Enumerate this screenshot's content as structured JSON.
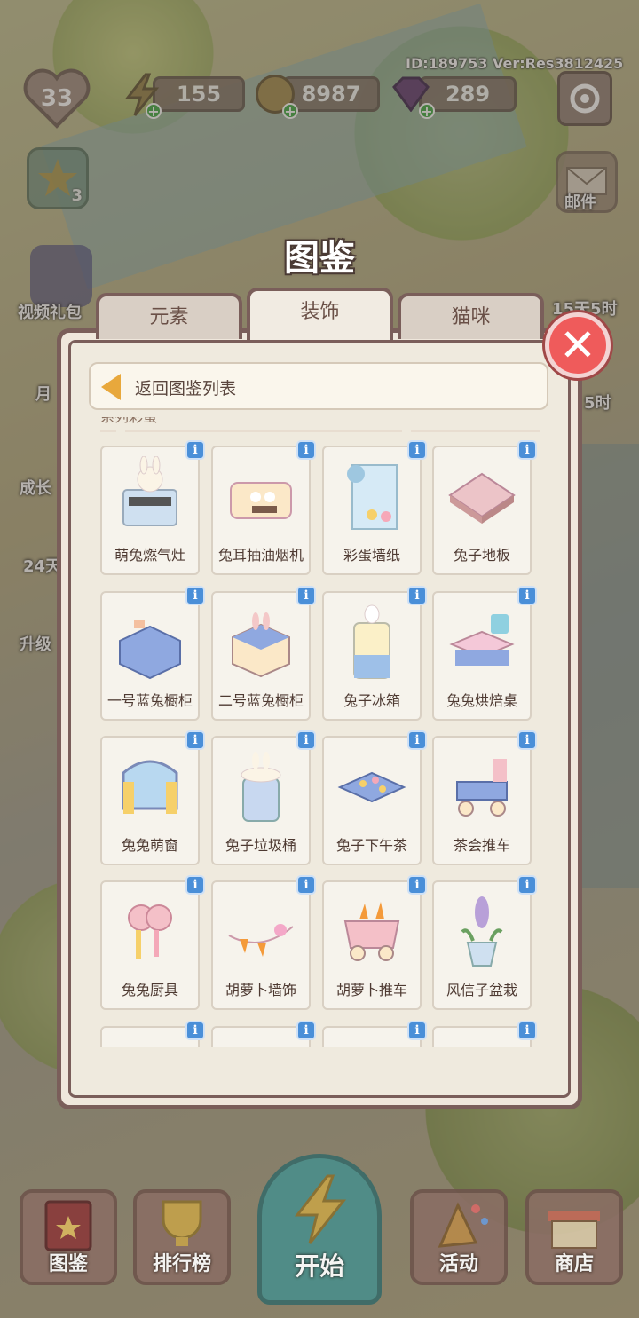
{
  "hud": {
    "id_version": "ID:189753  Ver:Res3812425",
    "level": "33",
    "energy": "155",
    "coins": "8987",
    "gems": "289"
  },
  "side_left": {
    "task_count": "3",
    "video_gift": "视频礼包",
    "month": "月",
    "growth": "成长",
    "days24": "24天",
    "upgrade": "升级"
  },
  "side_right": {
    "mail": "邮件",
    "timer1": "15天5时",
    "timer2": "5时"
  },
  "title": "图鉴",
  "tabs": [
    {
      "label": "元素",
      "active": false
    },
    {
      "label": "装饰",
      "active": true
    },
    {
      "label": "猫咪",
      "active": false
    }
  ],
  "back_label": "返回图鉴列表",
  "section_partial": "系列彩蛋",
  "items": [
    {
      "name": "萌兔燃气灶",
      "icon": "bunny-stove-icon"
    },
    {
      "name": "兔耳抽油烟机",
      "icon": "bunny-range-hood-icon"
    },
    {
      "name": "彩蛋墙纸",
      "icon": "egg-wallpaper-icon"
    },
    {
      "name": "兔子地板",
      "icon": "bunny-floor-icon"
    },
    {
      "name": "一号蓝兔橱柜",
      "icon": "blue-cabinet-1-icon"
    },
    {
      "name": "二号蓝兔橱柜",
      "icon": "blue-cabinet-2-icon"
    },
    {
      "name": "兔子冰箱",
      "icon": "bunny-fridge-icon"
    },
    {
      "name": "兔兔烘焙桌",
      "icon": "baking-table-icon"
    },
    {
      "name": "兔兔萌窗",
      "icon": "bunny-window-icon"
    },
    {
      "name": "兔子垃圾桶",
      "icon": "bunny-trashcan-icon"
    },
    {
      "name": "兔子下午茶",
      "icon": "afternoon-tea-icon"
    },
    {
      "name": "茶会推车",
      "icon": "tea-cart-icon"
    },
    {
      "name": "兔兔厨具",
      "icon": "kitchen-utensils-icon"
    },
    {
      "name": "胡萝卜墙饰",
      "icon": "carrot-wall-decor-icon"
    },
    {
      "name": "胡萝卜推车",
      "icon": "carrot-cart-icon"
    },
    {
      "name": "风信子盆栽",
      "icon": "hyacinth-pot-icon"
    }
  ],
  "info_label": "i",
  "close_label": "✕",
  "bottom": {
    "collection": "图鉴",
    "ranking": "排行榜",
    "start": "开始",
    "event": "活动",
    "shop": "商店"
  },
  "colors": {
    "accent_close": "#ef5b5b",
    "info_badge": "#4a8fd8",
    "panel_border": "#7a5e5a",
    "start_button": "#4c8e8a"
  }
}
